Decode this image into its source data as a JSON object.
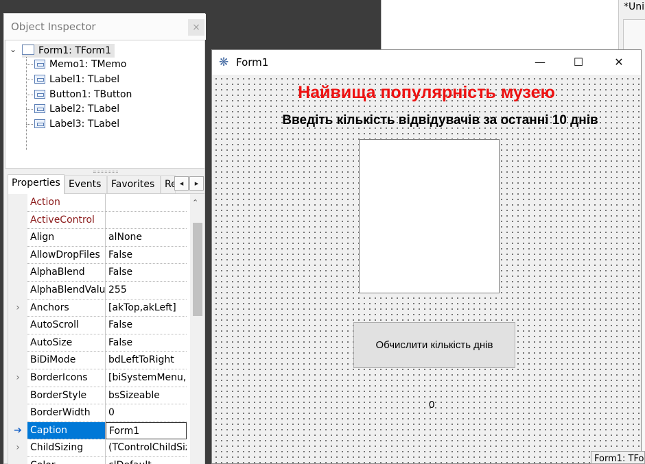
{
  "background_editor": {
    "title": "*Uni",
    "status": "Form1: TFo"
  },
  "object_inspector": {
    "title": "Object Inspector",
    "close": "×",
    "tree": {
      "root": "Form1: TForm1",
      "children": [
        "Memo1: TMemo",
        "Label1: TLabel",
        "Button1: TButton",
        "Label2: TLabel",
        "Label3: TLabel"
      ]
    },
    "tabs": [
      "Properties",
      "Events",
      "Favorites",
      "Re"
    ],
    "properties": [
      {
        "name": "Action",
        "value": "",
        "gutter": ""
      },
      {
        "name": "ActiveControl",
        "value": "",
        "gutter": ""
      },
      {
        "name": "Align",
        "value": "alNone",
        "gutter": ""
      },
      {
        "name": "AllowDropFiles",
        "value": "False",
        "gutter": ""
      },
      {
        "name": "AlphaBlend",
        "value": "False",
        "gutter": ""
      },
      {
        "name": "AlphaBlendValu",
        "value": "255",
        "gutter": ""
      },
      {
        "name": "Anchors",
        "value": "[akTop,akLeft]",
        "gutter": "›"
      },
      {
        "name": "AutoScroll",
        "value": "False",
        "gutter": ""
      },
      {
        "name": "AutoSize",
        "value": "False",
        "gutter": ""
      },
      {
        "name": "BiDiMode",
        "value": "bdLeftToRight",
        "gutter": ""
      },
      {
        "name": "BorderIcons",
        "value": "[biSystemMenu,l",
        "gutter": "›"
      },
      {
        "name": "BorderStyle",
        "value": "bsSizeable",
        "gutter": ""
      },
      {
        "name": "BorderWidth",
        "value": "0",
        "gutter": ""
      },
      {
        "name": "Caption",
        "value": "Form1",
        "gutter": "➔"
      },
      {
        "name": "ChildSizing",
        "value": "(TControlChildSiz",
        "gutter": "›"
      },
      {
        "name": "Color",
        "value": "clDefault",
        "gutter": ""
      }
    ]
  },
  "form": {
    "title": "Form1",
    "label1": "Найвища популярність музею",
    "label2": "Введіть кількість відвідувачів за останні 10 днів",
    "button1": "Обчислити кількість днів",
    "label3": "0"
  },
  "colors": {
    "label1": "#ee1111",
    "selection": "#0078d7",
    "property_name_highlight": "#8b1a1a"
  }
}
